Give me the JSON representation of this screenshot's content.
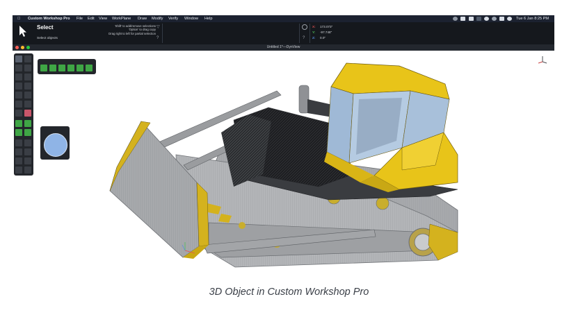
{
  "menubar": {
    "apple_icon": "apple-icon",
    "app_name": "Custom Workshop Pro",
    "items": [
      "File",
      "Edit",
      "View",
      "WorkPlane",
      "Draw",
      "Modify",
      "Verify",
      "Window",
      "Help"
    ],
    "clock": "Tue 6 Jan  8:25 PM"
  },
  "tool_info": {
    "title": "Select",
    "hint_1": "'Shift' to add/remove selections",
    "hint_2": "'Option' to drag copy",
    "hint_3": "Drag right to left for partial selection",
    "status": "Select objects"
  },
  "coords": {
    "x_label": "X:",
    "x_value": "173.073\"",
    "y_label": "Y:",
    "y_value": "-97.748\"",
    "z_label": "Z:",
    "z_value": "0.0\""
  },
  "window": {
    "title": "Untitled 1*—DynView"
  },
  "caption": "3D Object in Custom Workshop Pro",
  "colors": {
    "body_yellow": "#e8c419",
    "steel_grey": "#a7a9ac",
    "hull_black": "#1e1f22",
    "glass_blue": "#9fb9d6"
  }
}
